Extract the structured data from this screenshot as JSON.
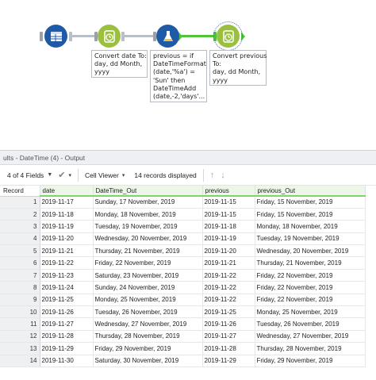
{
  "workflow": {
    "annotations": {
      "convert1": "Convert date To:\nday, dd Month,\nyyyy",
      "formula": "previous = if\nDateTimeFormat\n(date,'%a') =\n'Sun' then\nDateTimeAdd\n(date,-2,'days'...",
      "convert2": "Convert previous\nTo:\nday, dd Month,\nyyyy"
    },
    "tools": [
      {
        "name": "input",
        "icon": "input-data-icon"
      },
      {
        "name": "datetime-1",
        "icon": "datetime-icon"
      },
      {
        "name": "formula",
        "icon": "formula-flask-icon"
      },
      {
        "name": "datetime-2",
        "icon": "datetime-icon"
      }
    ]
  },
  "results": {
    "title": "ults - DateTime (4) - Output",
    "fields_label": "4 of 4 Fields",
    "viewer_label": "Cell Viewer",
    "records_label": "14 records displayed",
    "columns": [
      "Record",
      "date",
      "DateTime_Out",
      "previous",
      "previous_Out"
    ],
    "rows": [
      [
        "1",
        "2019-11-17",
        "Sunday, 17 November, 2019",
        "2019-11-15",
        "Friday, 15 November, 2019"
      ],
      [
        "2",
        "2019-11-18",
        "Monday, 18 November, 2019",
        "2019-11-15",
        "Friday, 15 November, 2019"
      ],
      [
        "3",
        "2019-11-19",
        "Tuesday, 19 November, 2019",
        "2019-11-18",
        "Monday, 18 November, 2019"
      ],
      [
        "4",
        "2019-11-20",
        "Wednesday, 20 November, 2019",
        "2019-11-19",
        "Tuesday, 19 November, 2019"
      ],
      [
        "5",
        "2019-11-21",
        "Thursday, 21 November, 2019",
        "2019-11-20",
        "Wednesday, 20 November, 2019"
      ],
      [
        "6",
        "2019-11-22",
        "Friday, 22 November, 2019",
        "2019-11-21",
        "Thursday, 21 November, 2019"
      ],
      [
        "7",
        "2019-11-23",
        "Saturday, 23 November, 2019",
        "2019-11-22",
        "Friday, 22 November, 2019"
      ],
      [
        "8",
        "2019-11-24",
        "Sunday, 24 November, 2019",
        "2019-11-22",
        "Friday, 22 November, 2019"
      ],
      [
        "9",
        "2019-11-25",
        "Monday, 25 November, 2019",
        "2019-11-22",
        "Friday, 22 November, 2019"
      ],
      [
        "10",
        "2019-11-26",
        "Tuesday, 26 November, 2019",
        "2019-11-25",
        "Monday, 25 November, 2019"
      ],
      [
        "11",
        "2019-11-27",
        "Wednesday, 27 November, 2019",
        "2019-11-26",
        "Tuesday, 26 November, 2019"
      ],
      [
        "12",
        "2019-11-28",
        "Thursday, 28 November, 2019",
        "2019-11-27",
        "Wednesday, 27 November, 2019"
      ],
      [
        "13",
        "2019-11-29",
        "Friday, 29 November, 2019",
        "2019-11-28",
        "Thursday, 28 November, 2019"
      ],
      [
        "14",
        "2019-11-30",
        "Saturday, 30 November, 2019",
        "2019-11-29",
        "Friday, 29 November, 2019"
      ]
    ]
  }
}
